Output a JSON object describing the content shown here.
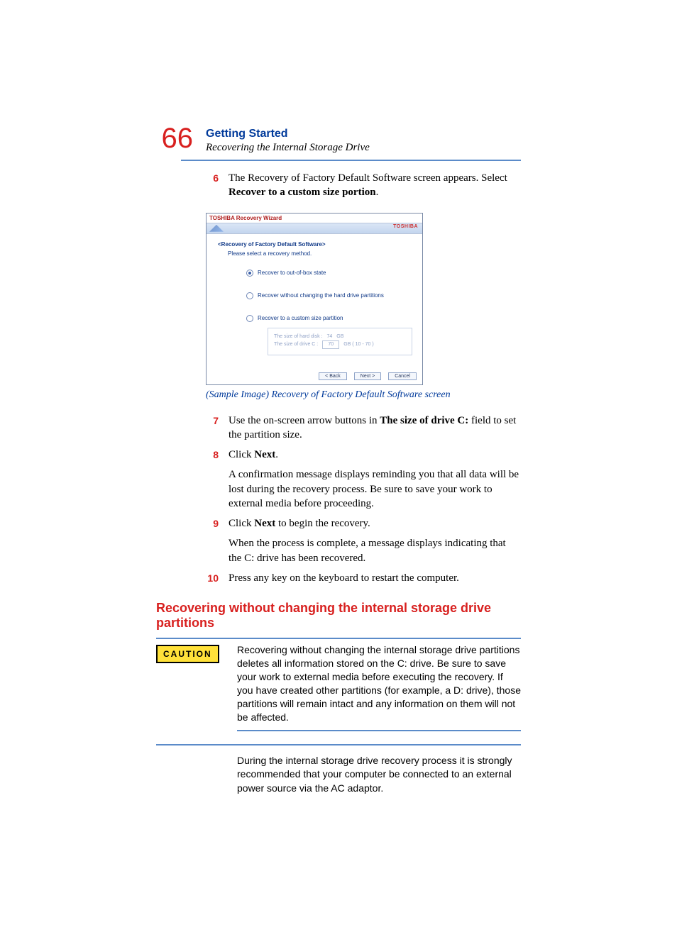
{
  "page_number": "66",
  "chapter": "Getting Started",
  "section": "Recovering the Internal Storage Drive",
  "steps_a": [
    {
      "n": "6",
      "paras": [
        "The Recovery of Factory Default Software screen appears. Select <b>Recover to a custom size portion</b>."
      ]
    }
  ],
  "figure": {
    "window_title": "TOSHIBA Recovery Wizard",
    "brand": "TOSHIBA",
    "heading": "<Recovery of Factory Default Software>",
    "subheading": "Please select a recovery method.",
    "options": [
      {
        "label": "Recover to out-of-box state",
        "selected": true
      },
      {
        "label": "Recover without changing the hard drive partitions",
        "selected": false
      },
      {
        "label": "Recover to a custom size partition",
        "selected": false
      }
    ],
    "custom": {
      "row1_label": "The size of hard disk :",
      "row1_value": "74",
      "row1_unit": "GB",
      "row2_label": "The size of drive C :",
      "row2_value": "70",
      "row2_unit": "GB  ( 10 - 70 )"
    },
    "buttons": {
      "back": "< Back",
      "next": "Next >",
      "cancel": "Cancel"
    }
  },
  "caption": "(Sample Image) Recovery of Factory Default Software screen",
  "steps_b": [
    {
      "n": "7",
      "paras": [
        "Use the on-screen arrow buttons in <b>The size of drive C:</b> field to set the partition size."
      ]
    },
    {
      "n": "8",
      "paras": [
        "Click <b>Next</b>.",
        "A confirmation message displays reminding you that all data will be lost during the recovery process. Be sure to save your work to external media before proceeding."
      ]
    },
    {
      "n": "9",
      "paras": [
        "Click <b>Next</b> to begin the recovery.",
        "When the process is complete, a message displays indicating that the C: drive has been recovered."
      ]
    },
    {
      "n": "10",
      "paras": [
        "Press any key on the keyboard to restart the computer."
      ]
    }
  ],
  "h2": "Recovering without changing the internal storage drive partitions",
  "caution_label": "CAUTION",
  "caution_text": "Recovering without changing the internal storage drive partitions deletes all information stored on the C: drive. Be sure to save your work to external media before executing the recovery. If you have created other partitions (for example, a D: drive), those partitions will remain intact and any information on them will not be affected.",
  "note_text": "During the internal storage drive recovery process it is strongly recommended that your computer be connected to an external power source via the AC adaptor."
}
